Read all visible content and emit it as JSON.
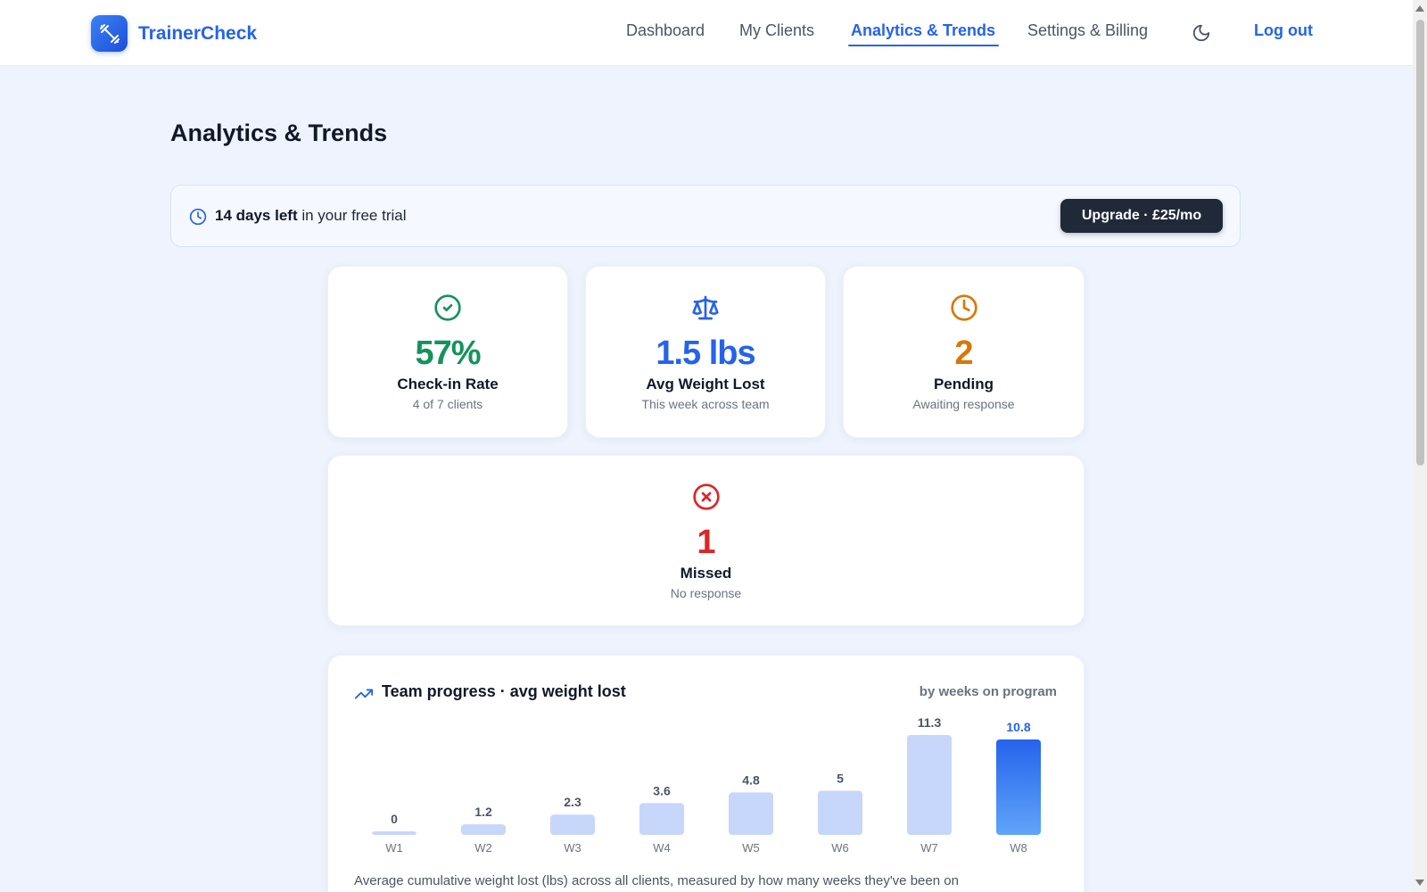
{
  "app": {
    "name": "TrainerCheck",
    "logo_icon": "dumbbell-icon"
  },
  "nav": {
    "items": [
      {
        "label": "Dashboard",
        "active": false
      },
      {
        "label": "My Clients",
        "active": false
      },
      {
        "label": "Analytics & Trends",
        "active": true
      },
      {
        "label": "Settings & Billing",
        "active": false
      }
    ],
    "theme_icon": "moon-icon",
    "logout_label": "Log out"
  },
  "page": {
    "title": "Analytics & Trends"
  },
  "trial": {
    "icon": "clock-icon",
    "days_left": "14 days left",
    "suffix": " in your free trial",
    "upgrade_label": "Upgrade · £25/mo"
  },
  "stats": [
    {
      "icon": "check-circle-icon",
      "value": "57%",
      "label": "Check-in Rate",
      "sub": "4 of 7 clients",
      "color": "#16925e"
    },
    {
      "icon": "scale-icon",
      "value": "1.5 lbs",
      "label": "Avg Weight Lost",
      "sub": "This week across team",
      "color": "#2563eb"
    },
    {
      "icon": "clock-icon",
      "value": "2",
      "label": "Pending",
      "sub": "Awaiting response",
      "color": "#d97706"
    },
    {
      "icon": "x-circle-icon",
      "value": "1",
      "label": "Missed",
      "sub": "No response",
      "color": "#dc2626"
    }
  ],
  "chart_card": {
    "icon": "trending-up-icon",
    "title": "Team progress · avg weight lost",
    "right_label": "by weeks on program",
    "description": "Average cumulative weight lost (lbs) across all clients, measured by how many weeks they've been on"
  },
  "chart_data": {
    "type": "bar",
    "categories": [
      "W1",
      "W2",
      "W3",
      "W4",
      "W5",
      "W6",
      "W7",
      "W8"
    ],
    "values": [
      0,
      1.2,
      2.3,
      3.6,
      4.8,
      5,
      11.3,
      10.8
    ],
    "highlight_index": 7,
    "title": "Team progress · avg weight lost",
    "xlabel": "",
    "ylabel": "",
    "colors": {
      "bar": "#c7d6fb",
      "highlight_top": "#2563eb",
      "highlight_bottom": "#60a5fa",
      "label": "#4b5563",
      "highlight_label": "#2563eb"
    }
  }
}
